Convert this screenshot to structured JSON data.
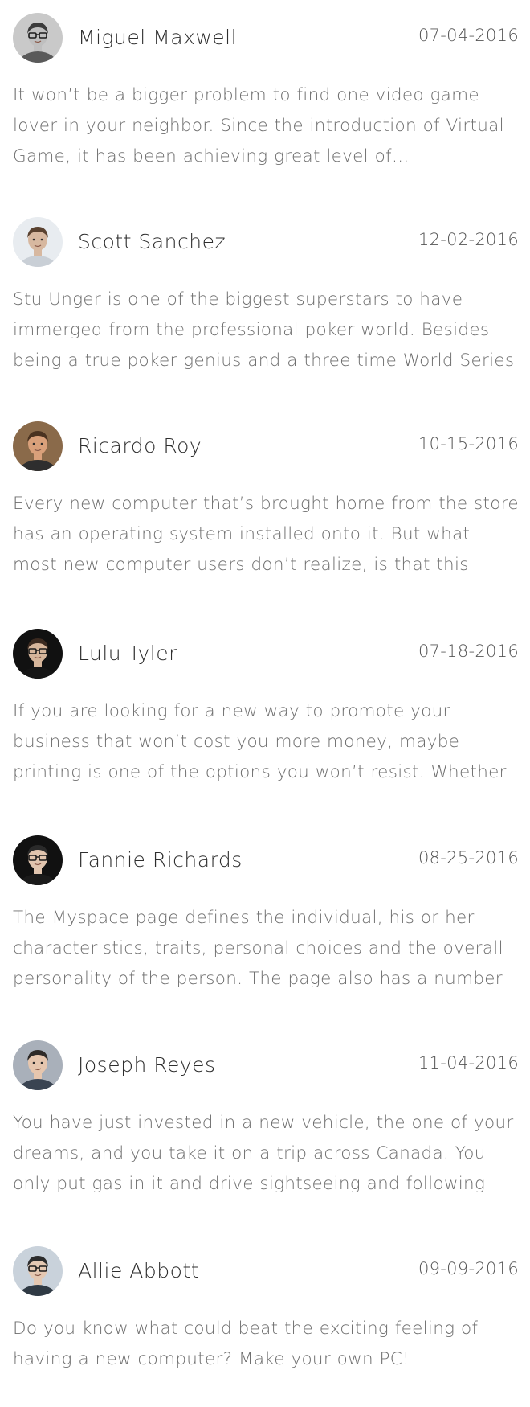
{
  "posts": [
    {
      "author": "Miguel Maxwell",
      "date": "07-04-2016",
      "excerpt": "It won’t be a bigger problem to find one video game lover in your neighbor. Since the introduction of Virtual Game, it has been achieving great level of…",
      "avatar_bg": "#c9c9c9",
      "skin": "#bfbfbf",
      "hair": "#3a3a3a",
      "shirt": "#5a5a5a",
      "glasses": true
    },
    {
      "author": "Scott Sanchez",
      "date": "12-02-2016",
      "excerpt": "Stu Unger is one of the biggest superstars to have immerged from the professional poker world. Besides being a true poker genius and a three time World Series of Poker champion, Stu Unger also has",
      "avatar_bg": "#e8ecf0",
      "skin": "#d7b8a0",
      "hair": "#5a4230",
      "shirt": "#c9cfd6",
      "glasses": false
    },
    {
      "author": "Ricardo Roy",
      "date": "10-15-2016",
      "excerpt": "Every new computer that’s brought home from the store has an operating system installed onto it. But what most new computer users don’t realize, is that this system needs regular maintenance to avoid",
      "avatar_bg": "#8a6a4a",
      "skin": "#d9a07a",
      "hair": "#4a3220",
      "shirt": "#2e2e2e",
      "glasses": false
    },
    {
      "author": "Lulu Tyler",
      "date": "07-18-2016",
      "excerpt": "If you are looking for a new way to promote your business that won’t cost you more money, maybe printing is one of the options you won’t resist. Whether you are printing flyers, brochures and more",
      "avatar_bg": "#111111",
      "skin": "#d6b59a",
      "hair": "#3b2a20",
      "shirt": "#151515",
      "glasses": true
    },
    {
      "author": "Fannie Richards",
      "date": "08-25-2016",
      "excerpt": "The Myspace page defines the individual, his or her characteristics, traits, personal choices and the overall personality of the person. The page also has a number of friends and a wide network of people",
      "avatar_bg": "#111111",
      "skin": "#e0c4ae",
      "hair": "#2a2a2a",
      "shirt": "#1a1a1a",
      "glasses": true
    },
    {
      "author": "Joseph Reyes",
      "date": "11-04-2016",
      "excerpt": "You have just invested in a new vehicle, the one of your dreams, and you take it on a trip across Canada. You only put gas in it and drive sightseeing and following your GPS all over the highways",
      "avatar_bg": "#a9b0ba",
      "skin": "#e6c6ae",
      "hair": "#2e2a28",
      "shirt": "#3a4452",
      "glasses": false
    },
    {
      "author": "Allie Abbott",
      "date": "09-09-2016",
      "excerpt": "Do you know what could beat the exciting feeling of having a new computer? Make your own PC!",
      "avatar_bg": "#c9d2db",
      "skin": "#e4c8b2",
      "hair": "#2c2c2c",
      "shirt": "#2f3a44",
      "glasses": true
    }
  ]
}
